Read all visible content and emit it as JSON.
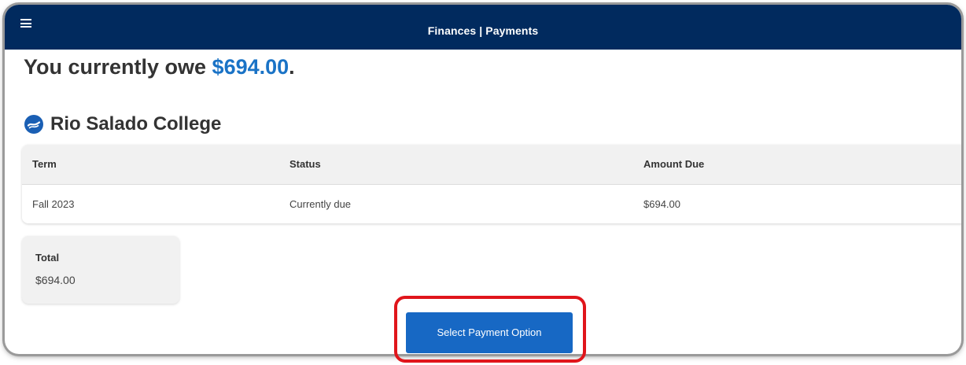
{
  "header": {
    "title": "Finances | Payments",
    "menu_icon": "hamburger-menu-icon",
    "background_color": "#012a5e"
  },
  "balance": {
    "prefix": "You currently owe ",
    "amount": "$694.00",
    "suffix": ".",
    "amount_color": "#1a73c6"
  },
  "college": {
    "name": "Rio Salado College",
    "logo_icon": "college-logo-icon"
  },
  "table": {
    "headers": {
      "term": "Term",
      "status": "Status",
      "amount_due": "Amount Due"
    },
    "rows": [
      {
        "term": "Fall 2023",
        "status": "Currently due",
        "amount_due": "$694.00"
      }
    ]
  },
  "total": {
    "label": "Total",
    "value": "$694.00"
  },
  "actions": {
    "select_payment_label": "Select Payment Option",
    "button_color": "#1768c4",
    "highlight_color": "#e0151b"
  }
}
